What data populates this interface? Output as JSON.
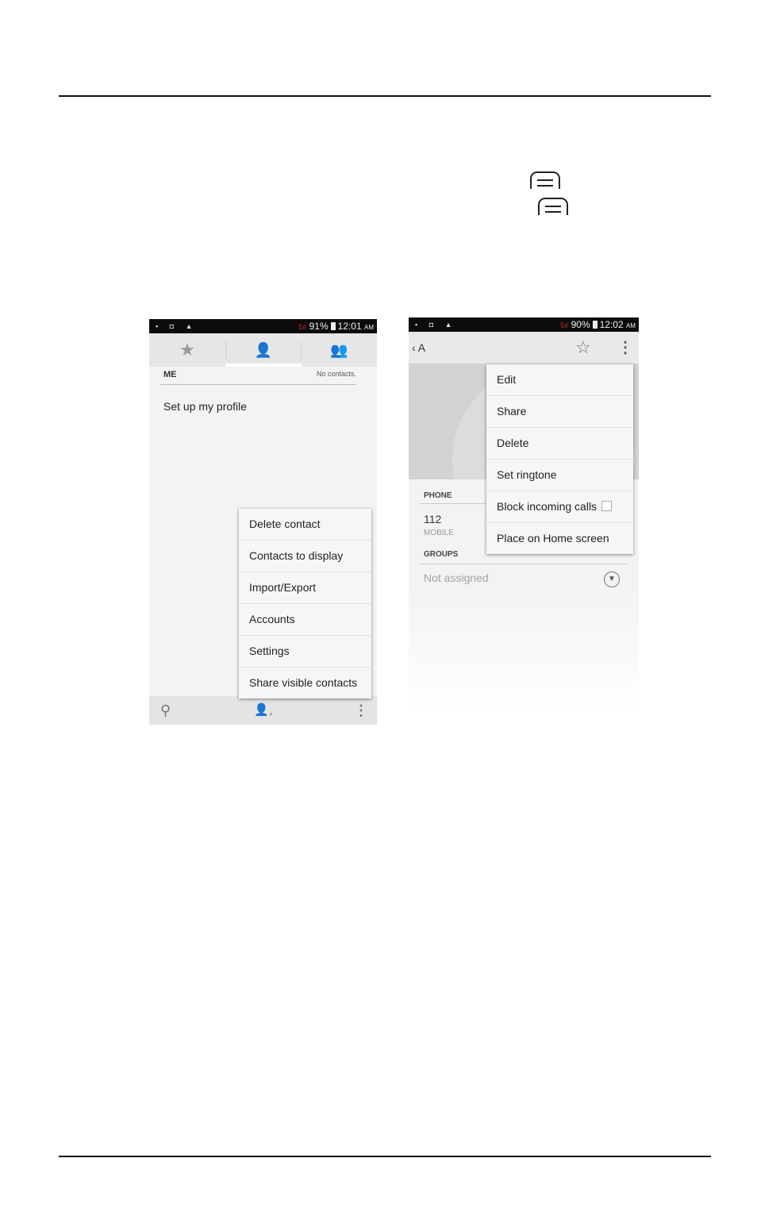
{
  "page": {
    "rules": 2
  },
  "left_phone": {
    "status": {
      "left_icons": "▪ ◘ ▲",
      "signal": "5ıl",
      "battery": "91%",
      "time": "12:01",
      "ampm": "AM"
    },
    "tabs": [
      {
        "icon": "star-icon",
        "glyph": "★"
      },
      {
        "icon": "person-icon",
        "glyph": "👤"
      },
      {
        "icon": "group-icon",
        "glyph": "👥"
      }
    ],
    "me_header": "ME",
    "contact_count": "No contacts.",
    "setup_profile": "Set up my profile",
    "menu": [
      "Delete contact",
      "Contacts to display",
      "Import/Export",
      "Accounts",
      "Settings",
      "Share visible contacts"
    ],
    "bottom_icons": [
      "search-icon",
      "add-contact-icon",
      "overflow-icon"
    ]
  },
  "right_phone": {
    "status": {
      "left_icons": "▪ ◘ ▲",
      "signal": "5ıl",
      "battery": "90%",
      "time": "12:02",
      "ampm": "AM"
    },
    "back_label": "‹ A",
    "phone_section": "PHONE",
    "phone_number": "112",
    "phone_type": "MOBILE",
    "groups_section": "GROUPS",
    "groups_value": "Not assigned",
    "menu": [
      "Edit",
      "Share",
      "Delete",
      "Set ringtone",
      "Block incoming calls",
      "Place on Home screen"
    ]
  }
}
